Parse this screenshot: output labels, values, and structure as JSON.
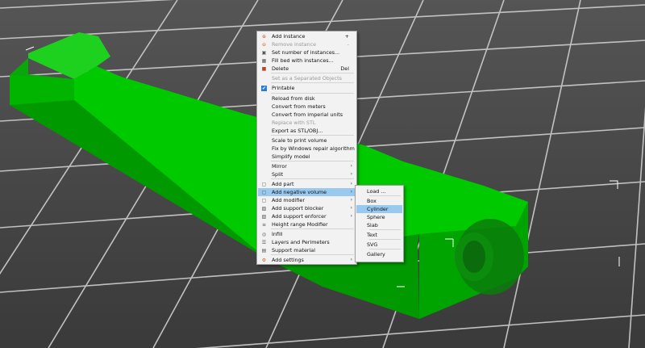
{
  "context_menu": {
    "items": [
      {
        "label": "Add instance",
        "shortcut": "+",
        "icon": "add-instance-icon",
        "color": "#e05a2b"
      },
      {
        "label": "Remove instance",
        "shortcut": "-",
        "icon": "remove-instance-icon",
        "color": "#e05a2b",
        "disabled": true
      },
      {
        "label": "Set number of instances...",
        "icon": "instances-icon"
      },
      {
        "label": "Fill bed with instances...",
        "icon": "fill-bed-icon"
      },
      {
        "label": "Delete",
        "shortcut": "Del",
        "icon": "delete-icon",
        "color": "#c4401f"
      },
      {
        "label": "Set as a Separated Objects",
        "disabled": true
      },
      {
        "label": "Printable",
        "icon": "checkmark-icon",
        "checked": true
      },
      {
        "label": "Reload from disk"
      },
      {
        "label": "Convert from meters"
      },
      {
        "label": "Convert from imperial units"
      },
      {
        "label": "Replace with STL",
        "disabled": true
      },
      {
        "label": "Export as STL/OBJ..."
      },
      {
        "label": "Scale to print volume"
      },
      {
        "label": "Fix by Windows repair algorithm"
      },
      {
        "label": "Simplify model"
      },
      {
        "label": "Mirror",
        "submenu": true
      },
      {
        "label": "Split",
        "submenu": true
      },
      {
        "label": "Add part",
        "submenu": true,
        "icon": "add-part-icon"
      },
      {
        "label": "Add negative volume",
        "submenu": true,
        "icon": "negative-volume-icon",
        "highlighted": true
      },
      {
        "label": "Add modifier",
        "submenu": true,
        "icon": "modifier-icon"
      },
      {
        "label": "Add support blocker",
        "submenu": true,
        "icon": "support-blocker-icon"
      },
      {
        "label": "Add support enforcer",
        "submenu": true,
        "icon": "support-enforcer-icon"
      },
      {
        "label": "Height range Modifier",
        "icon": "height-range-icon"
      },
      {
        "label": "Infill",
        "icon": "infill-icon"
      },
      {
        "label": "Layers and Perimeters",
        "icon": "layers-icon"
      },
      {
        "label": "Support material",
        "icon": "support-material-icon"
      },
      {
        "label": "Add settings",
        "submenu": true,
        "icon": "settings-icon",
        "color": "#e05a2b"
      }
    ]
  },
  "submenu": {
    "items": [
      {
        "label": "Load ..."
      },
      {
        "label": "Box"
      },
      {
        "label": "Cylinder",
        "highlighted": true
      },
      {
        "label": "Sphere"
      },
      {
        "label": "Slab"
      },
      {
        "label": "Text"
      },
      {
        "label": "SVG"
      },
      {
        "label": "Gallery"
      }
    ]
  },
  "colors": {
    "background": "#3f3f3f",
    "grid": "#d0d0d0",
    "model": "#00c400",
    "menu_bg": "#f2f2f2",
    "highlight": "#99c9ef",
    "accent": "#e05a2b"
  }
}
